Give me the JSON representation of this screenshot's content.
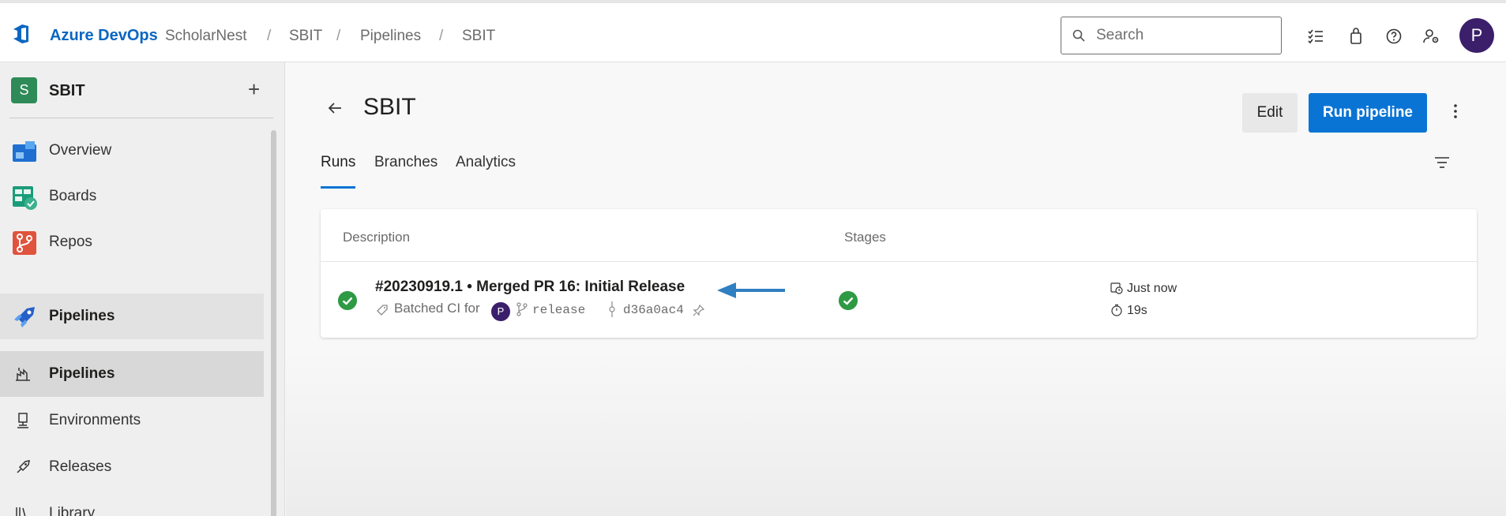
{
  "header": {
    "brand": "Azure DevOps",
    "breadcrumbs": [
      "ScholarNest",
      "SBIT",
      "Pipelines",
      "SBIT"
    ],
    "separator": "/",
    "search_placeholder": "Search",
    "icons": [
      "task-list-icon",
      "shopping-bag-icon",
      "help-icon",
      "user-settings-icon"
    ],
    "avatar_initial": "P",
    "accent_color": "#0a66c2"
  },
  "sidebar": {
    "project_initial": "S",
    "project_name": "SBIT",
    "add_label": "+",
    "items": [
      {
        "label": "Overview",
        "icon": "overview-icon"
      },
      {
        "label": "Boards",
        "icon": "boards-icon"
      },
      {
        "label": "Repos",
        "icon": "repos-icon"
      },
      {
        "label": "Pipelines",
        "icon": "pipelines-icon"
      }
    ],
    "sub_items": [
      {
        "label": "Pipelines",
        "icon": "pipelines-sub-icon"
      },
      {
        "label": "Environments",
        "icon": "environments-icon"
      },
      {
        "label": "Releases",
        "icon": "releases-icon"
      },
      {
        "label": "Library",
        "icon": "library-icon"
      }
    ]
  },
  "main": {
    "title": "SBIT",
    "edit_label": "Edit",
    "run_label": "Run pipeline",
    "tabs": [
      {
        "label": "Runs",
        "active": true
      },
      {
        "label": "Branches",
        "active": false
      },
      {
        "label": "Analytics",
        "active": false
      }
    ],
    "table": {
      "columns": [
        "Description",
        "Stages"
      ],
      "rows": [
        {
          "status": "succeeded",
          "title": "#20230919.1 • Merged PR 16: Initial Release",
          "trigger": "Batched CI for",
          "user_initial": "P",
          "branch": "release",
          "commit": "d36a0ac4",
          "stage_status": "succeeded",
          "when": "Just now",
          "duration": "19s"
        }
      ]
    },
    "success_color": "#2e9a44",
    "button_color": "#0a74d4"
  }
}
